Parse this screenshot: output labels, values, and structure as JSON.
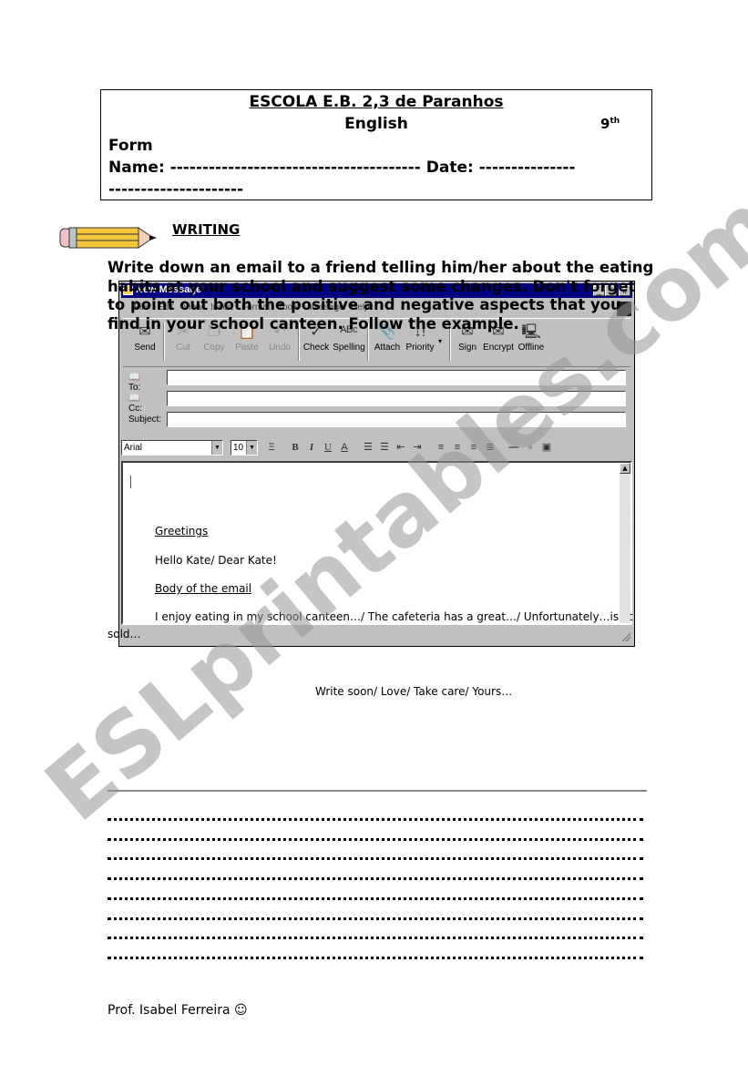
{
  "header": {
    "school": "ESCOLA E.B. 2,3 de Paranhos",
    "subject": "English",
    "grade_number": "9",
    "grade_suffix": "th",
    "form_label": "Form",
    "name_line": "Name:  --------------------------------------- Date: ---------------",
    "continuation_line": "---------------------"
  },
  "section": {
    "icon": "pencil-icon",
    "heading": "WRITING",
    "instructions": "Write down an email to a friend telling him/her about the eating habits at your school and suggest some changes. Don't forget to point out both the positive and negative aspects that you find in your school canteen. Follow the example."
  },
  "email_window": {
    "title": "New Message",
    "title_buttons": [
      "_",
      "□",
      "x"
    ],
    "menu": [
      "File",
      "Edit",
      "View",
      "Insert",
      "Format",
      "Tools",
      "Message",
      "Help"
    ],
    "toolbar": [
      {
        "label": "Send",
        "icon": "send-icon",
        "glyph": "✉",
        "enabled": true
      },
      {
        "label": "Cut",
        "icon": "scissors-icon",
        "glyph": "✂",
        "enabled": false
      },
      {
        "label": "Copy",
        "icon": "copy-icon",
        "glyph": "❐",
        "enabled": false
      },
      {
        "label": "Paste",
        "icon": "paste-icon",
        "glyph": "📋",
        "enabled": false
      },
      {
        "label": "Undo",
        "icon": "undo-icon",
        "glyph": "↶",
        "enabled": false
      },
      {
        "label": "Check",
        "icon": "check-names-icon",
        "glyph": "✓",
        "enabled": true
      },
      {
        "label": "Spelling",
        "icon": "spelling-icon",
        "glyph": "ᴬᴮᶜ",
        "enabled": true
      },
      {
        "label": "Attach",
        "icon": "paperclip-icon",
        "glyph": "📎",
        "enabled": true
      },
      {
        "label": "Priority",
        "icon": "priority-icon",
        "glyph": "↓!",
        "enabled": true
      },
      {
        "label": "Sign",
        "icon": "sign-icon",
        "glyph": "✉",
        "enabled": true
      },
      {
        "label": "Encrypt",
        "icon": "encrypt-icon",
        "glyph": "✉",
        "enabled": true
      },
      {
        "label": "Offline",
        "icon": "offline-icon",
        "glyph": "🖳",
        "enabled": true
      }
    ],
    "fields": {
      "to_label": "To:",
      "cc_label": "Cc:",
      "subject_label": "Subject:",
      "to_value": "",
      "cc_value": "",
      "subject_value": ""
    },
    "format": {
      "font": "Arial",
      "size": "10",
      "buttons": [
        {
          "name": "paragraph-style-icon",
          "glyph": "Ξ"
        },
        {
          "name": "bold-icon",
          "glyph": "B"
        },
        {
          "name": "italic-icon",
          "glyph": "I"
        },
        {
          "name": "underline-icon",
          "glyph": "U"
        },
        {
          "name": "font-color-icon",
          "glyph": "A"
        },
        {
          "name": "numbered-list-icon",
          "glyph": "☰"
        },
        {
          "name": "bullet-list-icon",
          "glyph": "☰"
        },
        {
          "name": "decrease-indent-icon",
          "glyph": "⇤"
        },
        {
          "name": "increase-indent-icon",
          "glyph": "⇥"
        },
        {
          "name": "align-left-icon",
          "glyph": "≡"
        },
        {
          "name": "align-center-icon",
          "glyph": "≡"
        },
        {
          "name": "align-right-icon",
          "glyph": "≡"
        },
        {
          "name": "justify-icon",
          "glyph": "≣"
        },
        {
          "name": "horizontal-line-icon",
          "glyph": "—"
        },
        {
          "name": "hyperlink-icon",
          "glyph": "●"
        },
        {
          "name": "insert-picture-icon",
          "glyph": "▣"
        }
      ]
    },
    "body": {
      "greetings_heading": "Greetings",
      "greeting": "Hello Kate/ Dear Kate!",
      "body_heading": "Body of the email",
      "body_text": "I enjoy eating in my school canteen…/ The cafeteria has a great…/ Unfortunately…isn't",
      "overflow_text": "sold…"
    }
  },
  "closing": "Write soon/ Love/ Take care/ Yours…",
  "answer_lines_count": 8,
  "footer": "Prof. Isabel Ferreira ☺",
  "watermark": "ESLprintables.com"
}
